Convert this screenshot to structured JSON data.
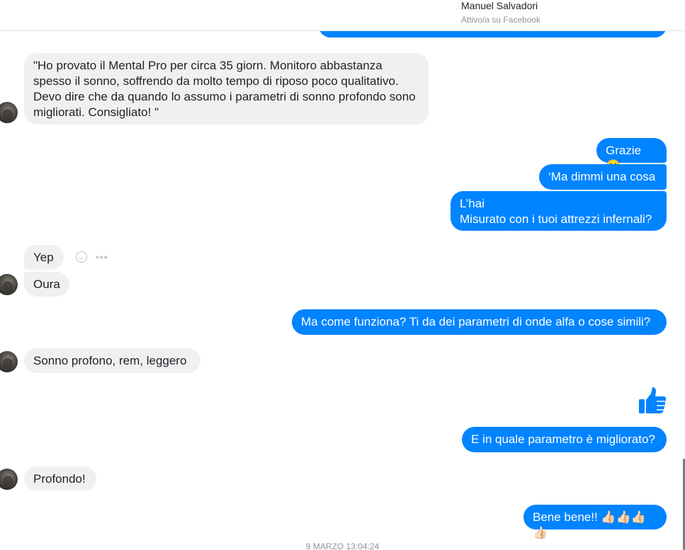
{
  "header": {
    "contact_name": "Manuel Salvadori",
    "status": "Attivo/a su Facebook"
  },
  "messages": {
    "m1_review": "\"Ho provato il Mental Pro per circa 35 giorn. Monitoro abbastanza spesso il sonno, soffrendo da molto tempo di riposo poco qualitativo. Devo dire che  da quando lo assumo i parametri di sonno profondo sono migliorati. Consigliato! \"",
    "m2_grazie": "Grazie 🙂",
    "m3_dimmi": "‘Ma dimmi una cosa",
    "m4_misurato": "L’hai\nMisurato con i tuoi attrezzi infernali?",
    "m5_yep": "Yep",
    "m6_oura": "Oura",
    "m7_funziona": "Ma come funziona? Ti da dei parametri di onde alfa o cose simili?",
    "m8_sonno": "Sonno profono, rem, leggero",
    "m9_parametro": "E in quale parametro è migliorato?",
    "m10_profondo": "Profondo!",
    "m11_bene": "Bene bene!! 👍🏻👍🏻👍🏻👍🏻"
  },
  "icons": {
    "react": "smiley-react-icon",
    "more": "more-options-icon",
    "like": "thumbs-up-icon",
    "avatar": "contact-avatar"
  },
  "colors": {
    "outgoing_bubble": "#0084ff",
    "incoming_bubble": "#f1f0f0"
  },
  "footer": {
    "timestamp": "9 MARZO 13:04:24"
  }
}
